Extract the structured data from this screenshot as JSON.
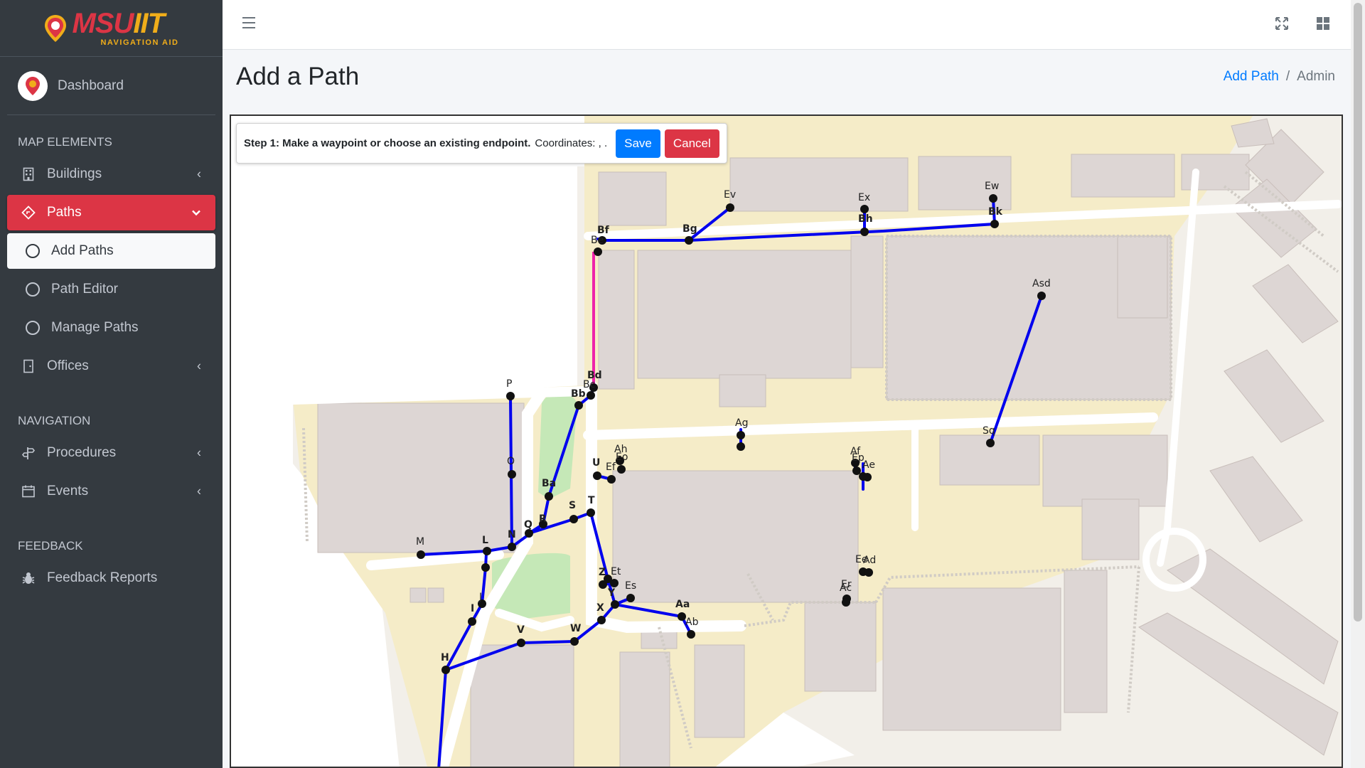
{
  "brand": {
    "name_part1": "MSU",
    "name_part2": "IIT",
    "subtitle": "NAVIGATION AID"
  },
  "user_panel": {
    "label": "Dashboard"
  },
  "sidebar": {
    "sections": [
      {
        "header": "MAP ELEMENTS"
      },
      {
        "header": "NAVIGATION"
      },
      {
        "header": "FEEDBACK"
      }
    ],
    "items": {
      "buildings": "Buildings",
      "paths": "Paths",
      "add_paths": "Add Paths",
      "path_editor": "Path Editor",
      "manage_paths": "Manage Paths",
      "offices": "Offices",
      "procedures": "Procedures",
      "events": "Events",
      "feedback_reports": "Feedback Reports"
    }
  },
  "header": {
    "page_title": "Add a Path"
  },
  "breadcrumb": {
    "link": "Add Path",
    "separator": "/",
    "current": "Admin"
  },
  "step_panel": {
    "step": "Step 1: Make a waypoint or choose an existing endpoint.",
    "coordinates_label": "Coordinates: , .",
    "save_label": "Save",
    "cancel_label": "Cancel"
  },
  "colors": {
    "accent": "#dc3545",
    "primary": "#007bff",
    "path": "#0000ee",
    "highlight_path": "#ee22aa",
    "sidebar_bg": "#343a40"
  },
  "icons": [
    "menu-icon",
    "expand-icon",
    "grid-icon",
    "building-icon",
    "route-icon",
    "door-icon",
    "signpost-icon",
    "calendar-icon",
    "bug-icon"
  ],
  "map": {
    "labels": [
      "Ev",
      "Ex",
      "Ew",
      "Bf",
      "Bg",
      "Bh",
      "Bk",
      "Be",
      "Asd",
      "Bd",
      "Bc",
      "Bb",
      "P",
      "Ag",
      "Ah",
      "Eo",
      "Ep",
      "U",
      "Ef",
      "Af",
      "Ae",
      "Sq",
      "O",
      "Ba",
      "S",
      "T",
      "R",
      "Q",
      "N",
      "M",
      "L",
      "Z",
      "Et",
      "Es",
      "Y",
      "X",
      "Aa",
      "Ab",
      "J",
      "I",
      "V",
      "W",
      "H",
      "Ac",
      "Ad",
      "Ee",
      "Er"
    ]
  }
}
